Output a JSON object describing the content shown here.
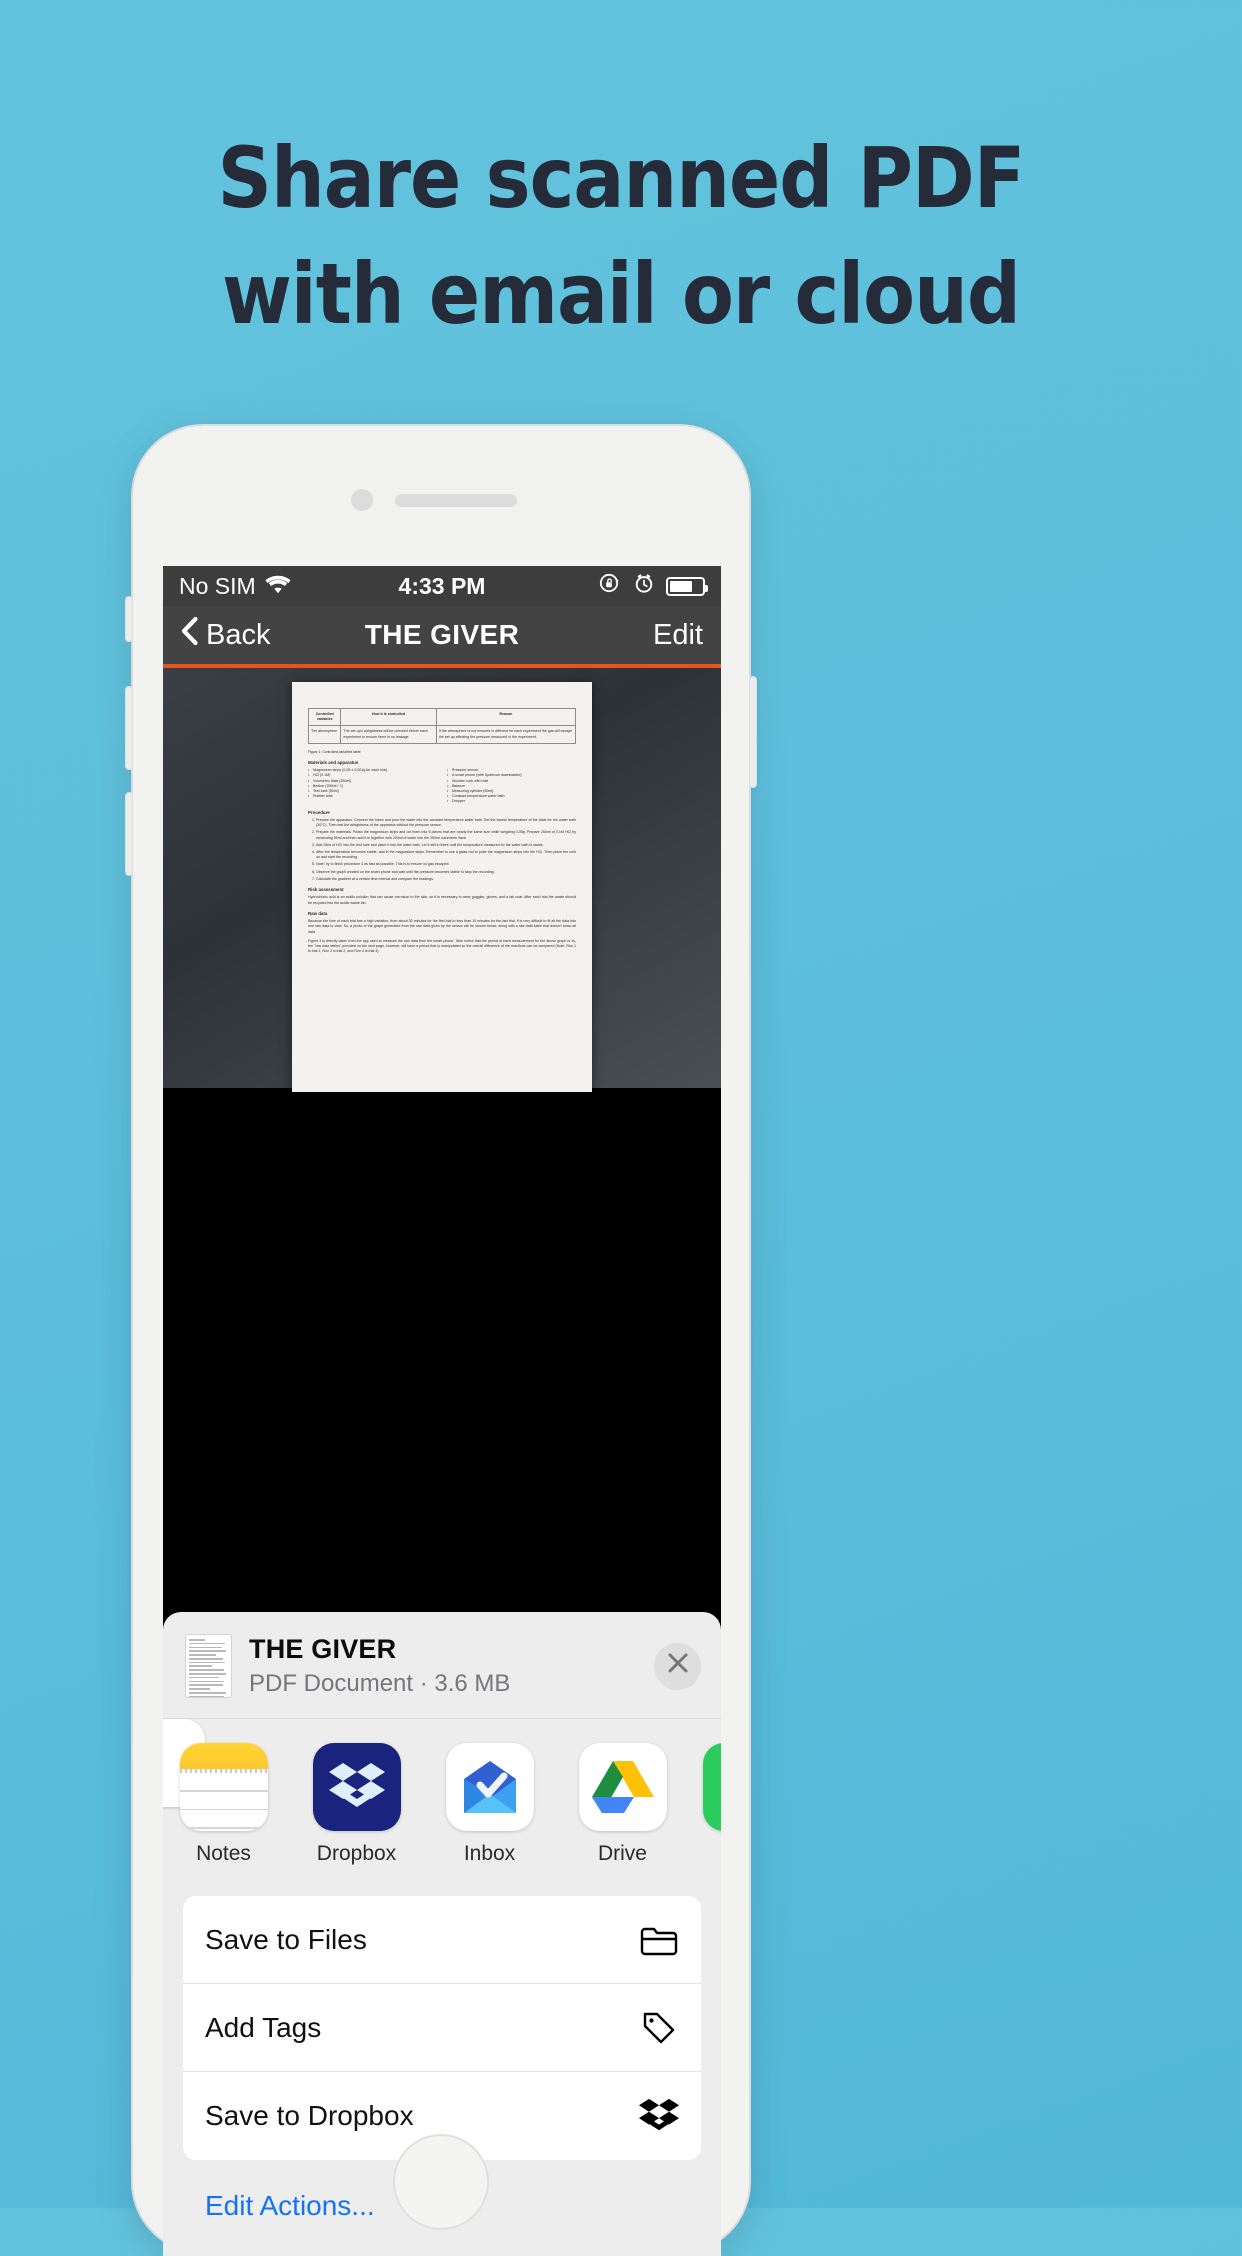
{
  "promo": {
    "headline_line1": "Share scanned PDF",
    "headline_line2": "with email or cloud",
    "background_color": "#5fc0dc",
    "headline_color": "#262b3a"
  },
  "phone": {
    "status_bar": {
      "carrier": "No SIM",
      "wifi_icon": "wifi-icon",
      "time": "4:33 PM",
      "rotation_lock_icon": "rotation-lock-icon",
      "alarm_icon": "alarm-clock-icon",
      "battery_icon": "battery-icon"
    },
    "nav_bar": {
      "back_icon": "chevron-left-icon",
      "back_label": "Back",
      "title": "THE GIVER",
      "edit_label": "Edit",
      "accent_color": "#e8541d"
    },
    "document_preview": {
      "table_headers": [
        "Controlled variables",
        "How it is controlled",
        "Reason"
      ],
      "table_rows": [
        [
          "The atmosphere",
          "The set-up's airtightness will be checked before each experiment to ensure there is no leakage.",
          "If the atmosphere is not ensured in different for each experiment the gas will escape the set-up affecting the pressure measured in the experiment."
        ]
      ],
      "caption": "Figure 1: Controlled variables table",
      "sections": [
        {
          "heading": "Materials and apparatus",
          "list_left": [
            "Magnesium strips (0.05 ± 0.001g for each trial)",
            "HCl (0.1M)",
            "Volumetric flask (250ml)",
            "Beaker (250ml * 2)",
            "Test tube (50ml)",
            "Rubber tube"
          ],
          "list_right": [
            "Pressure sensor",
            "A smart phone (with Sparkvue downloaded)",
            "Wooden cork with hole",
            "Balance",
            "Measuring cylinder (50ml)",
            "Constant temperature water bath",
            "Dropper"
          ]
        },
        {
          "heading": "Procedure",
          "steps": [
            "Prepare the apparatus. Connect the tubes and pour the water into the constant temperature water bath. Set the lowest temperature of the trials for the water bath (30°C). Then test the airtightness of the apparatus without the pressure sensor.",
            "Prepare the materials. Polish the magnesium strips and cut them into 6 pieces that are nearly the same size while weighing 0.05g. Prepare 250ml of 0.1M HCl by measuring 50ml and then add it in together with 200ml of water into the 250ml volumetric flask.",
            "Add 25ml of HCl into the test tube and place it into the water bath. Let it still in there until the temperature measured for the water bath is stable.",
            "After the temperature becomes stable, add in the magnesium strips. Remember to use a glass rod to poke the magnesium strips into the HCl. Then place the cork on and start the recording.",
            "Note: try to finish procedure 4 as fast as possible. This is to ensure no gas escaped.",
            "Observe the graph created on the smart phone and wait until the pressure becomes stable to stop the recording.",
            "Calculate the gradient at a certain time interval and compare the readings."
          ]
        },
        {
          "heading": "Risk assessment",
          "text": "Hydrochloric acid is an acidic solution that can cause corrosion to the skin, so it is necessary to wear goggles, gloves, and a lab coat. After each trial the waste should be recycled into the acidic waste bin."
        },
        {
          "heading": "Raw data",
          "text": "Because the time of each trial has a high variation, from about 30 minutes for the first trial to less than 10 minutes for the last trial, it is very difficult to fit all the data into one raw data to view. So, a photo of the graph generated from the raw data given by the sensor will be shown below, along with a raw data table that doesn't show all data."
        },
        {
          "heading": "",
          "text": "Figure 3 is directly taken from the app used to measure the raw data from the smart phone. Take notice that the period of each measurement for the above graph is 1s, the \"raw data tables\" provided on the next page, however, will have a period that is manipulated so the overall difference of the reactions can be compared (Note: Run 1 is trial 1, Run 3 is trial 2, and Run 4 is trial 3)."
        }
      ]
    },
    "share_sheet": {
      "document_title": "THE GIVER",
      "document_subtitle": "PDF Document · 3.6 MB",
      "close_icon": "close-icon",
      "thumbnail_icon": "document-thumbnail",
      "apps": [
        {
          "label": "Notes",
          "icon": "notes-app-icon"
        },
        {
          "label": "Dropbox",
          "icon": "dropbox-app-icon"
        },
        {
          "label": "Inbox",
          "icon": "inbox-app-icon"
        },
        {
          "label": "Drive",
          "icon": "google-drive-app-icon"
        }
      ],
      "actions": [
        {
          "label": "Save to Files",
          "icon": "folder-icon"
        },
        {
          "label": "Add Tags",
          "icon": "tag-icon"
        },
        {
          "label": "Save to Dropbox",
          "icon": "dropbox-icon"
        }
      ],
      "edit_actions_label": "Edit Actions...",
      "edit_actions_color": "#1474f0"
    }
  }
}
